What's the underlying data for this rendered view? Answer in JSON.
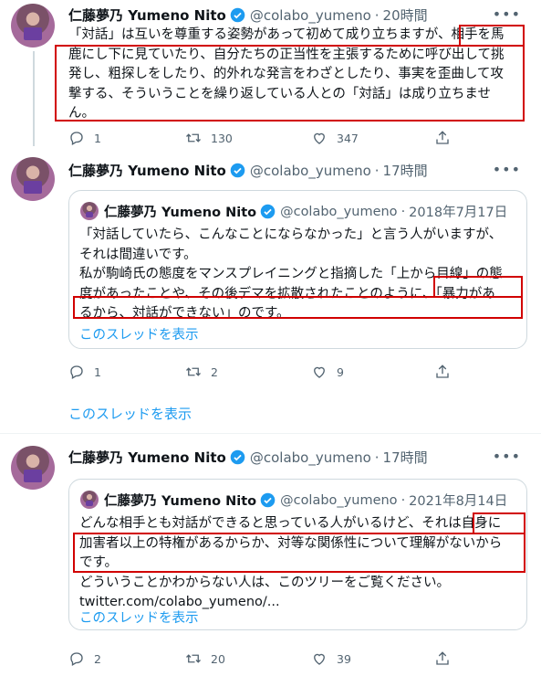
{
  "colors": {
    "accent": "#1d9bf0",
    "highlight": "#d10000",
    "muted": "#536471"
  },
  "tweets": [
    {
      "name": "仁藤夢乃 Yumeno Nito",
      "handle": "@colabo_yumeno",
      "time": "20時間",
      "text_lines": [
        "「対話」は互いを尊重する姿勢があって初めて成り立ちますが、相手を馬",
        "鹿にし下に見ていたり、自分たちの正当性を主張するために呼び出して挑",
        "発し、粗探しをしたり、的外れな発言をわざとしたり、事実を歪曲して攻",
        "撃する、そういうことを繰り返している人との「対話」は成り立ちませ",
        "ん。"
      ],
      "replies": "1",
      "retweets": "130",
      "likes": "347"
    },
    {
      "name": "仁藤夢乃 Yumeno Nito",
      "handle": "@colabo_yumeno",
      "time": "17時間",
      "quote": {
        "name": "仁藤夢乃 Yumeno Nito",
        "handle": "@colabo_yumeno",
        "date": "2018年7月17日",
        "text_lines": [
          "「対話していたら、こんなことにならなかった」と言う人がいますが、",
          "それは間違いです。",
          "私が駒崎氏の態度をマンスプレイニングと指摘した「上から目線」の態",
          "度があったことや、その後デマを拡散されたことのように、「暴力があ",
          "るから、対話ができない」のです。"
        ],
        "show_thread": "このスレッドを表示"
      },
      "replies": "1",
      "retweets": "2",
      "likes": "9",
      "show_thread": "このスレッドを表示"
    },
    {
      "name": "仁藤夢乃 Yumeno Nito",
      "handle": "@colabo_yumeno",
      "time": "17時間",
      "quote": {
        "name": "仁藤夢乃 Yumeno Nito",
        "handle": "@colabo_yumeno",
        "date": "2021年8月14日",
        "text_lines": [
          "どんな相手とも対話ができると思っている人がいるけど、それは自身に",
          "加害者以上の特権があるからか、対等な関係性について理解がないから",
          "です。",
          "どういうことかわからない人は、このツリーをご覧ください。"
        ],
        "link": "twitter.com/colabo_yumeno/...",
        "show_thread": "このスレッドを表示"
      },
      "replies": "2",
      "retweets": "20",
      "likes": "39"
    }
  ]
}
